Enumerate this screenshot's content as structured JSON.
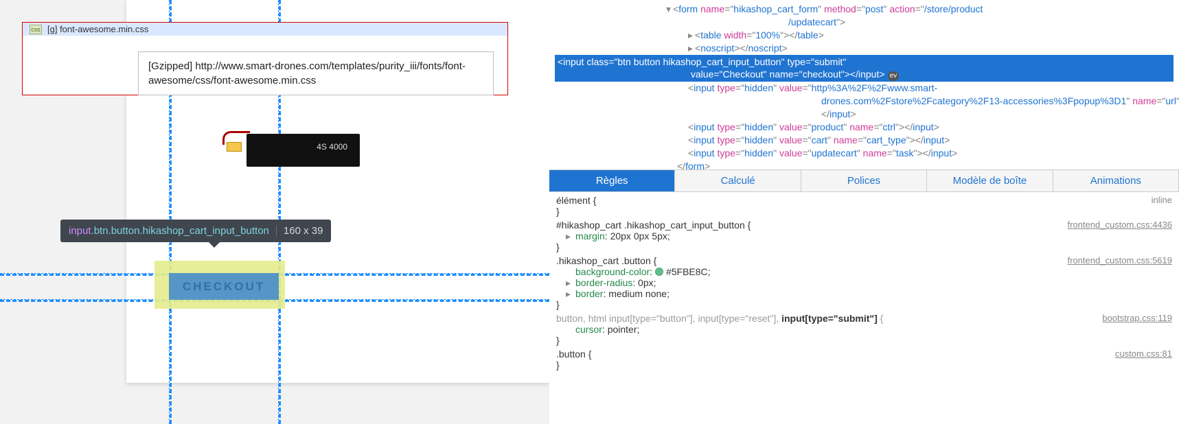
{
  "preview": {
    "css_row_label": "[g] font-awesome.min.css",
    "css_tooltip": "[Gzipped] http://www.smart-drones.com/templates/purity_iii/fonts/font-awesome/css/font-awesome.min.css",
    "battery_label": "4S 4000",
    "sel_tag": "input",
    "sel_class": ".btn.button.hikashop_cart_input_button",
    "sel_dim": "160 x 39",
    "checkout_label": "CHECKOUT"
  },
  "dom": {
    "l_form": "<form name=\"hikashop_cart_form\" method=\"post\" action=\"/store/product/updatecart\">",
    "l_table": "<table width=\"100%\"></table>",
    "l_noscript": "<noscript></noscript>",
    "l_sel": "<input class=\"btn button hikashop_cart_input_button\" type=\"submit\" value=\"Checkout\" name=\"checkout\"></input>",
    "l_url_a": "<input type=\"hidden\" value=\"http%3A%2F%2Fwww.smart-",
    "l_url_b": "drones.com%2Fstore%2Fcategory%2F13-accessories%3Fpopup%3D1\" name=\"url\">",
    "l_url_c": "</input>",
    "l_ctrl": "<input type=\"hidden\" value=\"product\" name=\"ctrl\"></input>",
    "l_cart": "<input type=\"hidden\" value=\"cart\" name=\"cart_type\"></input>",
    "l_task": "<input type=\"hidden\" value=\"updatecart\" name=\"task\"></input>",
    "l_form_end": "</form>",
    "ev_label": "ev"
  },
  "tabs": [
    "Règles",
    "Calculé",
    "Polices",
    "Modèle de boîte",
    "Animations"
  ],
  "rules": [
    {
      "selector": "élément {",
      "props": [],
      "source": "inline",
      "src_class": "inline"
    },
    {
      "selector": "#hikashop_cart .hikashop_cart_input_button {",
      "props": [
        {
          "name": "margin",
          "val": "20px 0px 5px",
          "tw": true
        }
      ],
      "source": "frontend_custom.css:4436"
    },
    {
      "selector": ".hikashop_cart .button {",
      "props": [
        {
          "name": "background-color",
          "val": "#5FBE8C",
          "swatch": "#5FBE8C"
        },
        {
          "name": "border-radius",
          "val": "0px",
          "tw": true
        },
        {
          "name": "border",
          "val": "medium none",
          "tw": true
        }
      ],
      "source": "frontend_custom.css:5619"
    },
    {
      "selector": "button, html input[type=\"button\"], input[type=\"reset\"], input[type=\"submit\"] {",
      "muted": true,
      "props": [
        {
          "name": "cursor",
          "val": "pointer"
        }
      ],
      "source": "bootstrap.css:119"
    },
    {
      "selector": ".button {",
      "props": [],
      "source": "custom.css:81"
    }
  ]
}
